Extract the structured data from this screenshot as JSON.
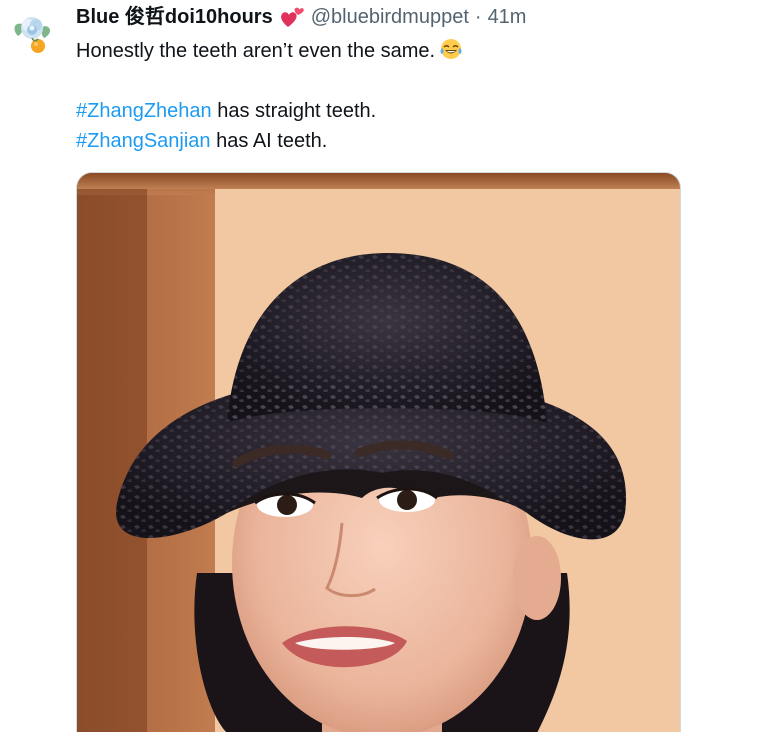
{
  "tweet": {
    "author": {
      "display_name": "Blue 俊哲doi10hours",
      "handle": "@bluebirdmuppet",
      "separator": "·",
      "time": "41m",
      "badge_icon": "two-hearts-emoji-icon",
      "avatar_icon": "flower-avatar-icon"
    },
    "text": {
      "line1": "Honestly the teeth aren’t even the same.",
      "line1_emoji_icon": "tears-of-joy-emoji-icon",
      "hashtag1": "#ZhangZhehan",
      "line2_rest": " has straight teeth.",
      "hashtag2": "#ZhangSanjian",
      "line3_rest": " has AI teeth."
    },
    "media": {
      "type": "photo",
      "icon": "photo-portrait-man-bucket-hat"
    },
    "colors": {
      "hashtag": "#1d9bf0",
      "secondary_text": "#536471",
      "primary_text": "#0f1419"
    }
  }
}
